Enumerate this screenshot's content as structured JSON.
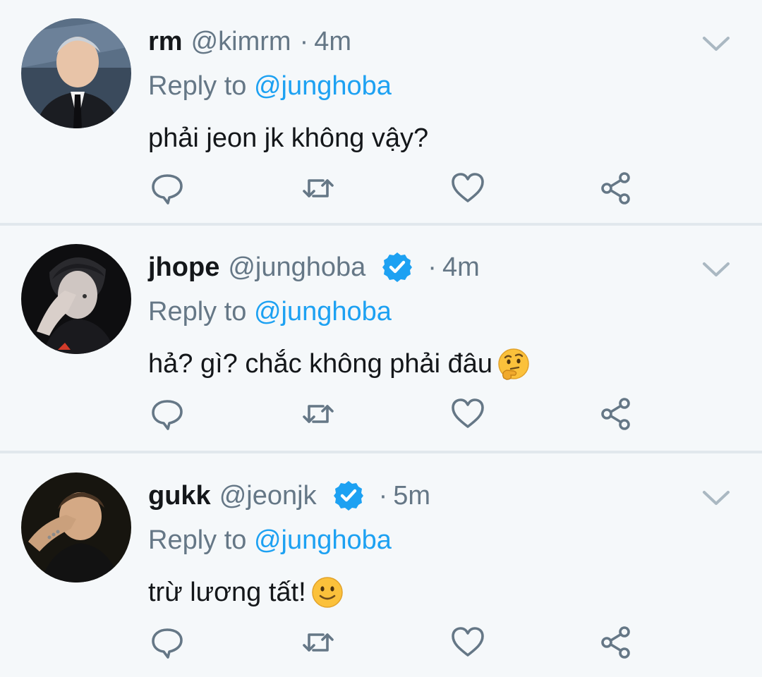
{
  "colors": {
    "background": "#f5f8fa",
    "divider": "#e1e8ed",
    "text": "#14171a",
    "secondary_text": "#657786",
    "link": "#1da1f2",
    "verified": "#1da1f2",
    "icon": "#657786"
  },
  "tweets": [
    {
      "name": "rm",
      "handle": "@kimrm",
      "verified": false,
      "separator": "·",
      "time": "4m",
      "reply_prefix": "Reply to",
      "reply_to": "@junghoba",
      "text": "phải jeon jk không vậy?",
      "emoji": null
    },
    {
      "name": "jhope",
      "handle": "@junghoba",
      "verified": true,
      "separator": "·",
      "time": "4m",
      "reply_prefix": "Reply to",
      "reply_to": "@junghoba",
      "text": "hả? gì? chắc không phải đâu",
      "emoji": "thinking-face-emoji"
    },
    {
      "name": "gukk",
      "handle": "@jeonjk",
      "verified": true,
      "separator": "·",
      "time": "5m",
      "reply_prefix": "Reply to",
      "reply_to": "@junghoba",
      "text": "trừ lương tất!",
      "emoji": "slightly-smiling-face-emoji"
    }
  ],
  "icons": {
    "reply": "reply-icon",
    "retweet": "retweet-icon",
    "like": "heart-icon",
    "share": "share-icon",
    "menu": "chevron-down-icon",
    "verified": "verified-badge-icon"
  }
}
